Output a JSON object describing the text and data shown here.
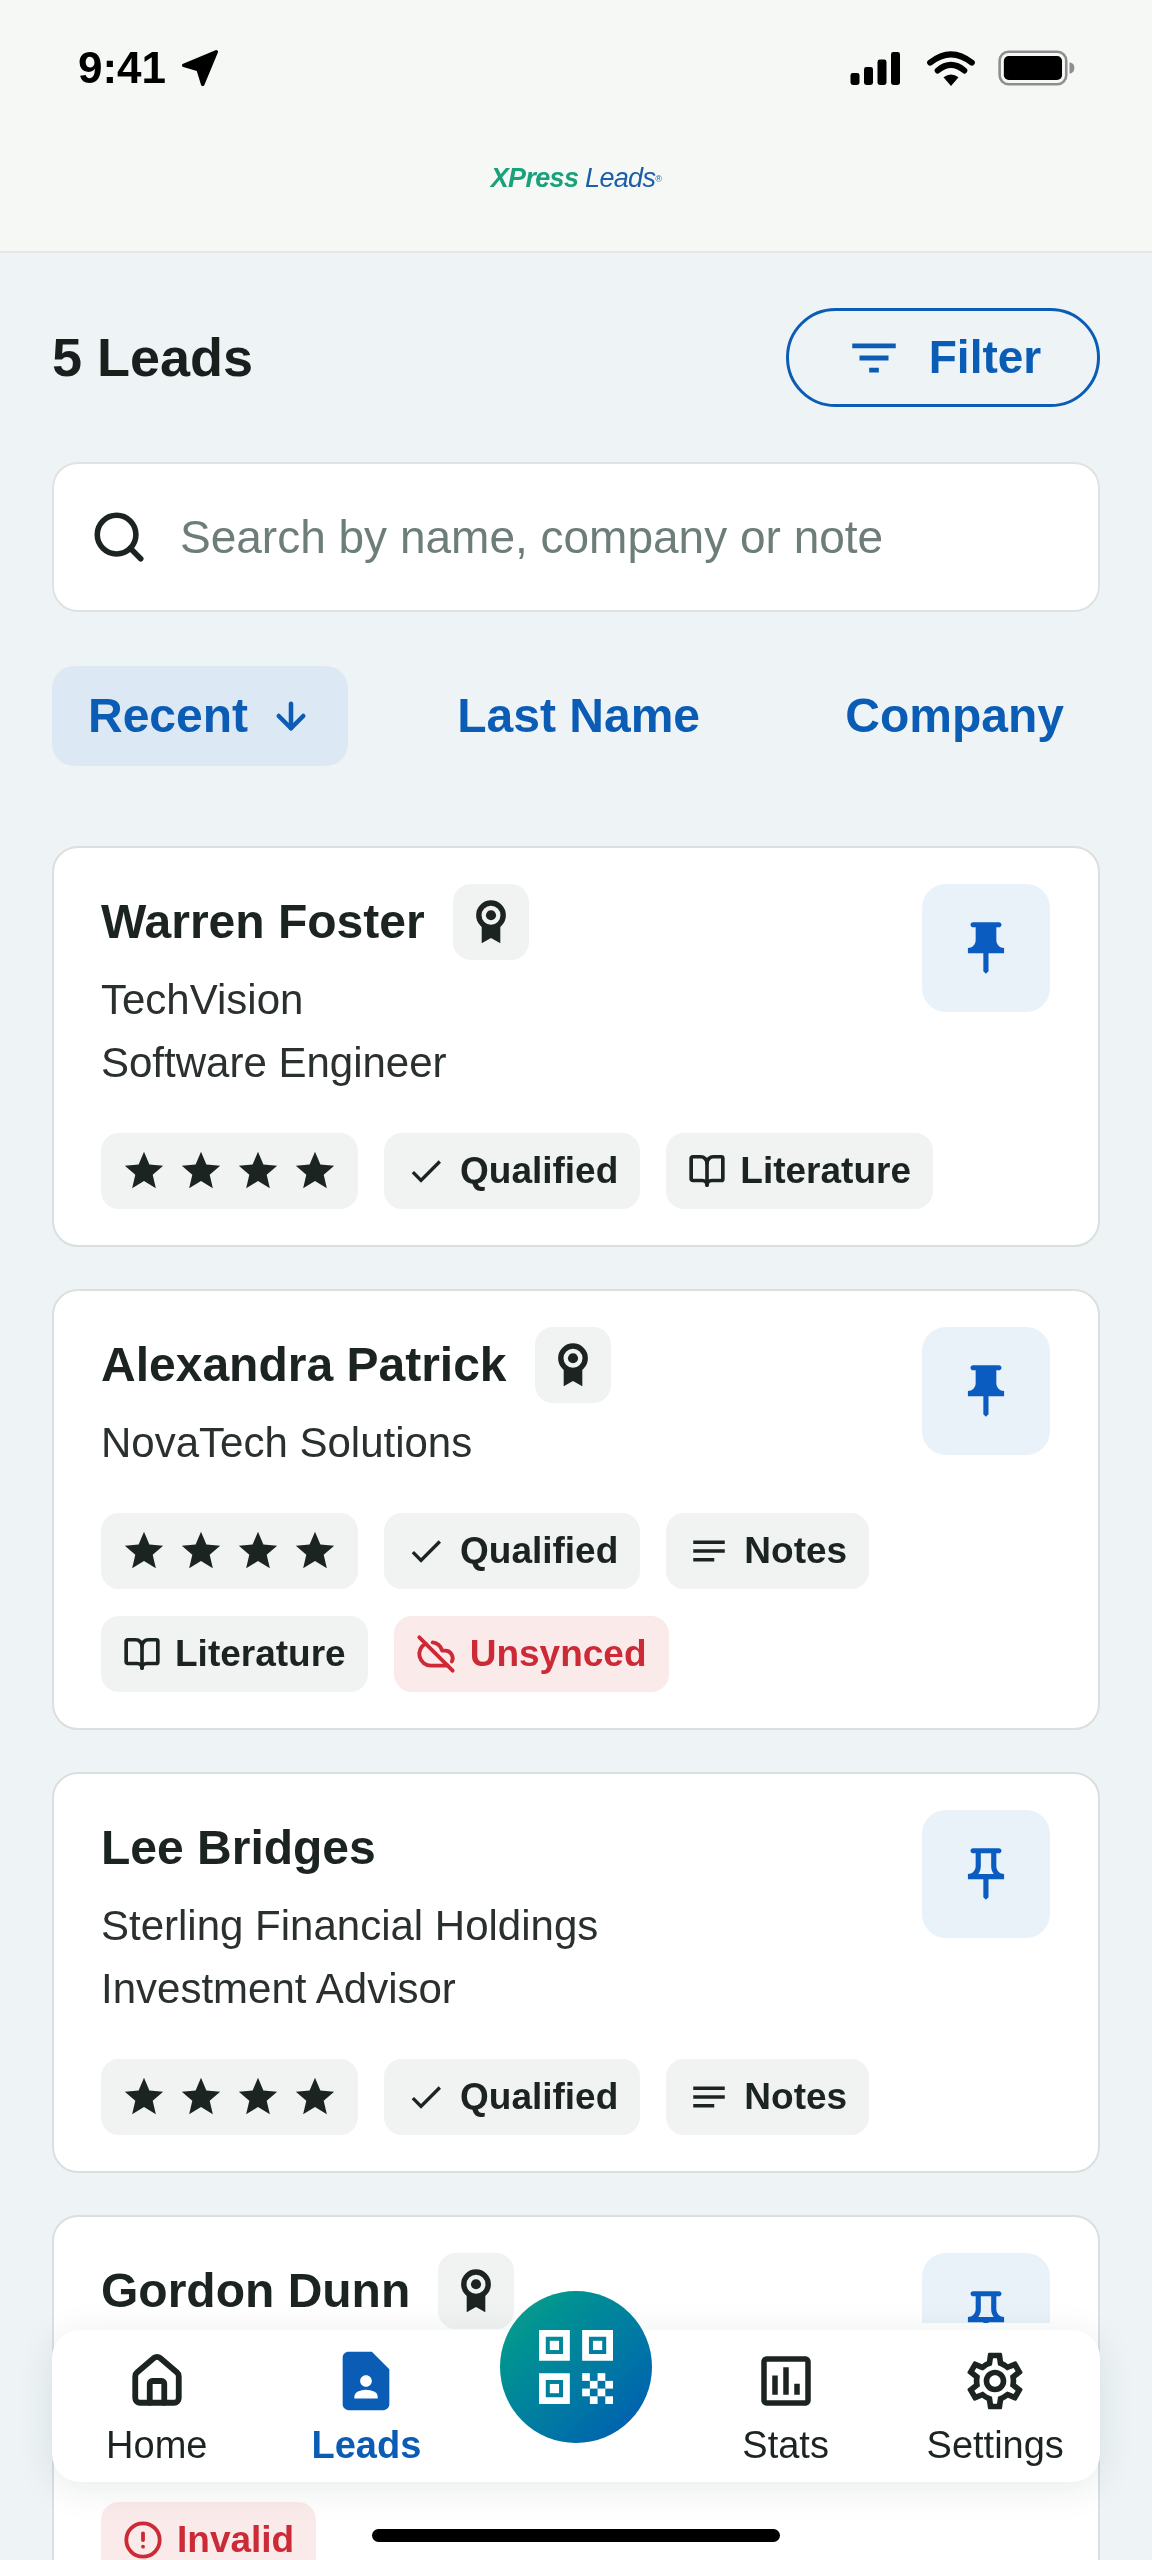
{
  "status_bar": {
    "time": "9:41"
  },
  "logo": {
    "brand": "XPress",
    "product": "Leads",
    "mark": "®"
  },
  "header": {
    "title": "5 Leads",
    "filter_button": "Filter"
  },
  "search": {
    "placeholder": "Search by name, company or note"
  },
  "sort_options": [
    {
      "label": "Recent",
      "selected": true
    },
    {
      "label": "Last Name",
      "selected": false
    },
    {
      "label": "Company",
      "selected": false
    }
  ],
  "leads": [
    {
      "name": "Warren Foster",
      "awarded": true,
      "pinned": true,
      "company": "TechVision",
      "job_title": "Software Engineer",
      "tags": [
        {
          "kind": "rating",
          "stars": 4
        },
        {
          "kind": "qualified",
          "label": "Qualified"
        },
        {
          "kind": "literature",
          "label": "Literature"
        }
      ]
    },
    {
      "name": "Alexandra Patrick",
      "awarded": true,
      "pinned": true,
      "company": "NovaTech Solutions",
      "tags": [
        {
          "kind": "rating",
          "stars": 4
        },
        {
          "kind": "qualified",
          "label": "Qualified"
        },
        {
          "kind": "notes",
          "label": "Notes"
        },
        {
          "kind": "literature",
          "label": "Literature"
        },
        {
          "kind": "unsynced",
          "label": "Unsynced"
        }
      ]
    },
    {
      "name": "Lee Bridges",
      "awarded": false,
      "pinned": false,
      "company": "Sterling Financial Holdings",
      "job_title": "Investment Advisor",
      "tags": [
        {
          "kind": "rating",
          "stars": 4
        },
        {
          "kind": "qualified",
          "label": "Qualified"
        },
        {
          "kind": "notes",
          "label": "Notes"
        }
      ]
    },
    {
      "name": "Gordon Dunn",
      "awarded": true,
      "pinned": false,
      "tags": [
        {
          "kind": "invalid",
          "label": "Invalid"
        }
      ]
    }
  ],
  "bottom_nav": {
    "items": [
      {
        "label": "Home",
        "selected": false
      },
      {
        "label": "Leads",
        "selected": true
      },
      {
        "label": "Stats",
        "selected": false
      },
      {
        "label": "Settings",
        "selected": false
      }
    ]
  }
}
